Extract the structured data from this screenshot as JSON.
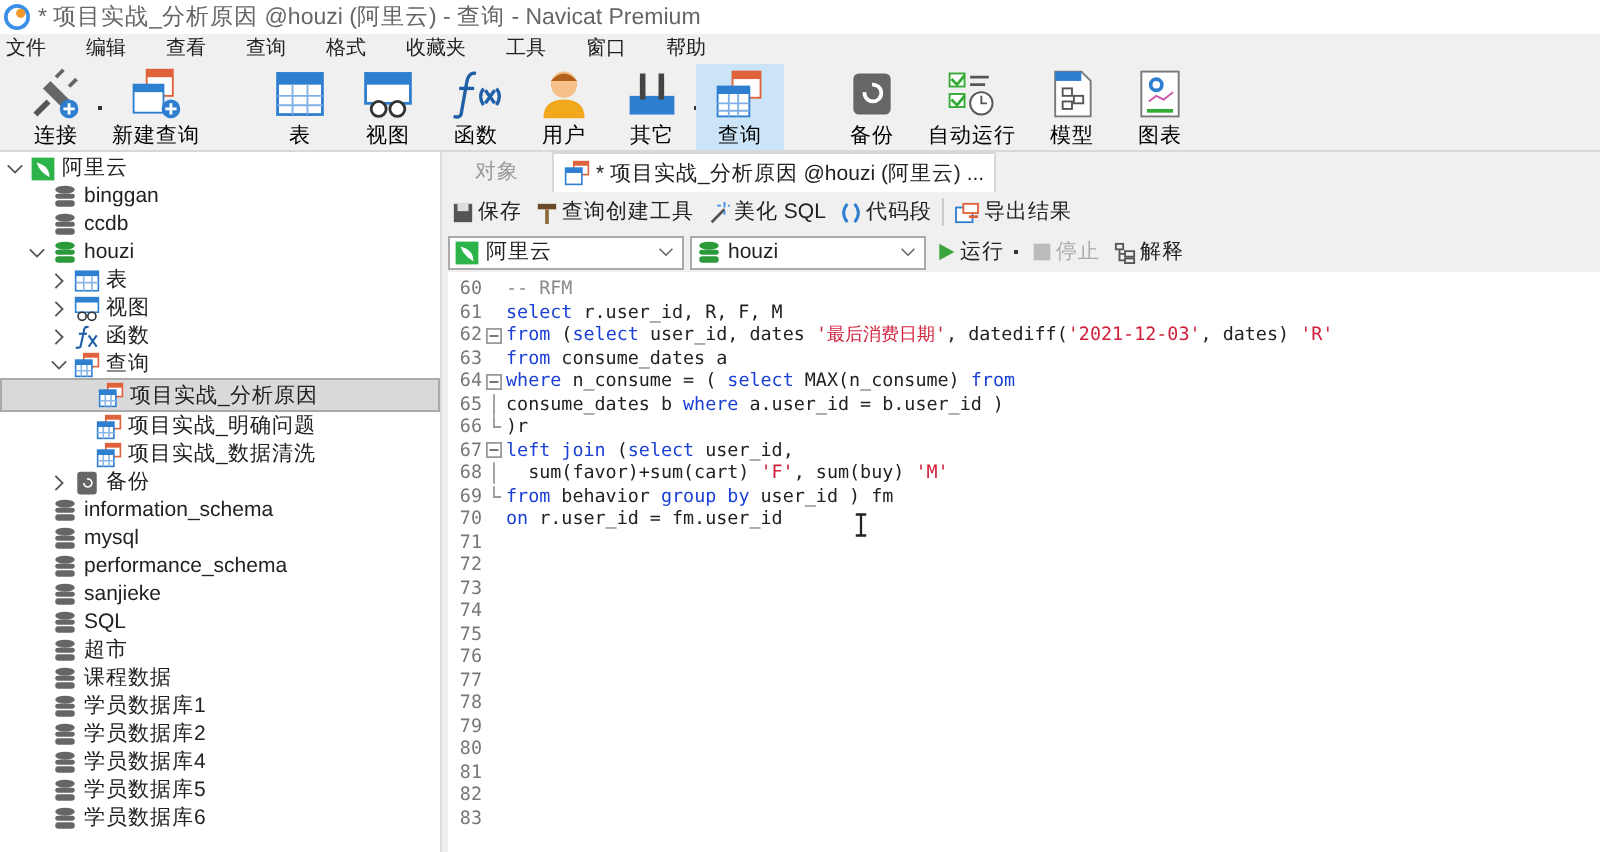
{
  "window": {
    "title": "* 项目实战_分析原因 @houzi (阿里云) - 查询 - Navicat Premium"
  },
  "menu": [
    "文件",
    "编辑",
    "查看",
    "查询",
    "格式",
    "收藏夹",
    "工具",
    "窗口",
    "帮助"
  ],
  "toolbar": [
    {
      "label": "连接",
      "kind": "plug",
      "dropdown": true,
      "selected": false
    },
    {
      "label": "新建查询",
      "kind": "newquery",
      "dropdown": false,
      "selected": false
    },
    {
      "label": "表",
      "kind": "table",
      "dropdown": false,
      "selected": false
    },
    {
      "label": "视图",
      "kind": "view",
      "dropdown": false,
      "selected": false
    },
    {
      "label": "函数",
      "kind": "function",
      "dropdown": false,
      "selected": false
    },
    {
      "label": "用户",
      "kind": "user",
      "dropdown": false,
      "selected": false
    },
    {
      "label": "其它",
      "kind": "tools",
      "dropdown": true,
      "selected": false
    },
    {
      "label": "查询",
      "kind": "query",
      "dropdown": false,
      "selected": true
    },
    {
      "label": "备份",
      "kind": "backup",
      "dropdown": false,
      "selected": false
    },
    {
      "label": "自动运行",
      "kind": "schedule",
      "dropdown": false,
      "selected": false
    },
    {
      "label": "模型",
      "kind": "model",
      "dropdown": false,
      "selected": false
    },
    {
      "label": "图表",
      "kind": "chart",
      "dropdown": false,
      "selected": false
    }
  ],
  "tree": [
    {
      "label": "阿里云",
      "kind": "connection",
      "expanded": true,
      "selected": false,
      "children": [
        {
          "label": "binggan",
          "kind": "database",
          "selected": false
        },
        {
          "label": "ccdb",
          "kind": "database",
          "selected": false
        },
        {
          "label": "houzi",
          "kind": "database-open",
          "expanded": true,
          "selected": false,
          "children": [
            {
              "label": "表",
              "kind": "table",
              "expanded": false,
              "selected": false
            },
            {
              "label": "视图",
              "kind": "view",
              "expanded": false,
              "selected": false
            },
            {
              "label": "函数",
              "kind": "function",
              "expanded": false,
              "selected": false
            },
            {
              "label": "查询",
              "kind": "query",
              "expanded": true,
              "selected": false,
              "children": [
                {
                  "label": "项目实战_分析原因",
                  "kind": "query",
                  "selected": true
                },
                {
                  "label": "项目实战_明确问题",
                  "kind": "query",
                  "selected": false
                },
                {
                  "label": "项目实战_数据清洗",
                  "kind": "query",
                  "selected": false
                }
              ]
            },
            {
              "label": "备份",
              "kind": "backup",
              "expanded": false,
              "selected": false
            }
          ]
        },
        {
          "label": "information_schema",
          "kind": "database",
          "selected": false
        },
        {
          "label": "mysql",
          "kind": "database",
          "selected": false
        },
        {
          "label": "performance_schema",
          "kind": "database",
          "selected": false
        },
        {
          "label": "sanjieke",
          "kind": "database",
          "selected": false
        },
        {
          "label": "SQL",
          "kind": "database",
          "selected": false
        },
        {
          "label": "超市",
          "kind": "database",
          "selected": false
        },
        {
          "label": "课程数据",
          "kind": "database",
          "selected": false
        },
        {
          "label": "学员数据库1",
          "kind": "database",
          "selected": false
        },
        {
          "label": "学员数据库2",
          "kind": "database",
          "selected": false
        },
        {
          "label": "学员数据库4",
          "kind": "database",
          "selected": false
        },
        {
          "label": "学员数据库5",
          "kind": "database",
          "selected": false
        },
        {
          "label": "学员数据库6",
          "kind": "database",
          "selected": false
        }
      ]
    }
  ],
  "tabs": [
    {
      "label": "对象",
      "kind": "plain",
      "selected": false
    },
    {
      "label": "* 项目实战_分析原因 @houzi (阿里云) ...",
      "kind": "query",
      "selected": true
    }
  ],
  "query_toolbar": [
    {
      "label": "保存",
      "kind": "save"
    },
    {
      "label": "查询创建工具",
      "kind": "builder"
    },
    {
      "label": "美化 SQL",
      "kind": "beautify"
    },
    {
      "label": "代码段",
      "kind": "snippet"
    },
    {
      "label": "导出结果",
      "kind": "export"
    }
  ],
  "connection_select": {
    "value": "阿里云"
  },
  "database_select": {
    "value": "houzi"
  },
  "run_buttons": [
    {
      "label": "运行",
      "kind": "run",
      "dropdown": true,
      "disabled": false
    },
    {
      "label": "停止",
      "kind": "stop",
      "dropdown": false,
      "disabled": true
    },
    {
      "label": "解释",
      "kind": "explain",
      "dropdown": false,
      "disabled": false
    }
  ],
  "editor": {
    "lines": [
      {
        "number": "60",
        "kind": "plain",
        "tokens": [
          {
            "kind": "comment",
            "text": "-- RFM"
          }
        ]
      },
      {
        "number": "61",
        "kind": "plain",
        "tokens": [
          {
            "kind": "keyword",
            "text": "select"
          },
          {
            "kind": "plain",
            "text": " r.user_id, R, F, M"
          }
        ]
      },
      {
        "number": "62",
        "kind": "fold-start",
        "tokens": [
          {
            "kind": "keyword",
            "text": "from"
          },
          {
            "kind": "plain",
            "text": " ("
          },
          {
            "kind": "keyword",
            "text": "select"
          },
          {
            "kind": "plain",
            "text": " user_id, dates "
          },
          {
            "kind": "string",
            "text": "'最后消费日期'"
          },
          {
            "kind": "plain",
            "text": ", datediff("
          },
          {
            "kind": "string",
            "text": "'2021-12-03'"
          },
          {
            "kind": "plain",
            "text": ", dates) "
          },
          {
            "kind": "string",
            "text": "'R'"
          }
        ]
      },
      {
        "number": "63",
        "kind": "plain",
        "tokens": [
          {
            "kind": "keyword",
            "text": "from"
          },
          {
            "kind": "plain",
            "text": " consume_dates a"
          }
        ]
      },
      {
        "number": "64",
        "kind": "fold-start",
        "tokens": [
          {
            "kind": "keyword",
            "text": "where"
          },
          {
            "kind": "plain",
            "text": " n_consume = ( "
          },
          {
            "kind": "keyword",
            "text": "select"
          },
          {
            "kind": "plain",
            "text": " MAX(n_consume) "
          },
          {
            "kind": "keyword",
            "text": "from"
          }
        ]
      },
      {
        "number": "65",
        "kind": "fold-mid",
        "tokens": [
          {
            "kind": "plain",
            "text": "consume_dates b "
          },
          {
            "kind": "keyword",
            "text": "where"
          },
          {
            "kind": "plain",
            "text": " a.user_id = b.user_id )"
          }
        ]
      },
      {
        "number": "66",
        "kind": "fold-end",
        "tokens": [
          {
            "kind": "plain",
            "text": ")r"
          }
        ]
      },
      {
        "number": "67",
        "kind": "fold-start",
        "tokens": [
          {
            "kind": "keyword",
            "text": "left join"
          },
          {
            "kind": "plain",
            "text": " ("
          },
          {
            "kind": "keyword",
            "text": "select"
          },
          {
            "kind": "plain",
            "text": " user_id,"
          }
        ]
      },
      {
        "number": "68",
        "kind": "fold-mid",
        "tokens": [
          {
            "kind": "plain",
            "text": "  sum(favor)+sum(cart) "
          },
          {
            "kind": "string",
            "text": "'F'"
          },
          {
            "kind": "plain",
            "text": ", sum(buy) "
          },
          {
            "kind": "string",
            "text": "'M'"
          }
        ]
      },
      {
        "number": "69",
        "kind": "fold-end",
        "tokens": [
          {
            "kind": "keyword",
            "text": "from"
          },
          {
            "kind": "plain",
            "text": " behavior "
          },
          {
            "kind": "keyword",
            "text": "group by"
          },
          {
            "kind": "plain",
            "text": " user_id ) fm"
          }
        ]
      },
      {
        "number": "70",
        "kind": "plain",
        "tokens": [
          {
            "kind": "keyword",
            "text": "on"
          },
          {
            "kind": "plain",
            "text": " r.user_id = fm.user_id"
          }
        ]
      },
      {
        "number": "71",
        "kind": "plain"
      },
      {
        "number": "72",
        "kind": "plain"
      },
      {
        "number": "73",
        "kind": "plain"
      },
      {
        "number": "74",
        "kind": "plain"
      },
      {
        "number": "75",
        "kind": "plain"
      },
      {
        "number": "76",
        "kind": "plain"
      },
      {
        "number": "77",
        "kind": "plain"
      },
      {
        "number": "78",
        "kind": "plain"
      },
      {
        "number": "79",
        "kind": "plain"
      },
      {
        "number": "80",
        "kind": "plain"
      },
      {
        "number": "81",
        "kind": "plain"
      },
      {
        "number": "82",
        "kind": "plain"
      },
      {
        "number": "83",
        "kind": "plain"
      }
    ]
  }
}
